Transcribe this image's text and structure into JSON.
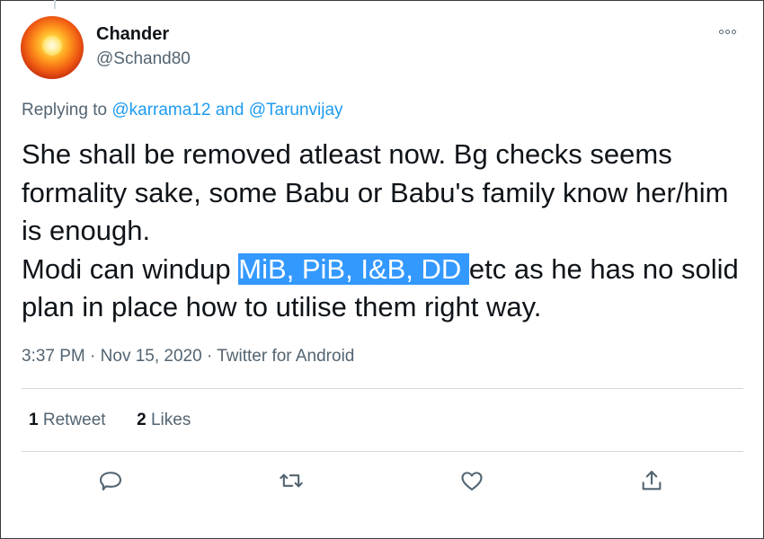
{
  "author": {
    "display_name": "Chander",
    "handle": "@Schand80"
  },
  "reply": {
    "prefix": "Replying to",
    "mention_1": "@karrama12",
    "conjunction": "and",
    "mention_2": "@Tarunvijay"
  },
  "tweet": {
    "line_1": "She shall be removed atleast now. Bg checks seems formality sake, some Babu or Babu's family know her/him is enough.",
    "line_2_before": "Modi can windup ",
    "line_2_highlight": "MiB, PiB, I&B, DD ",
    "line_2_after": "etc as he has no solid plan in place how to utilise them right way.",
    "highlight_color": "#3399ff"
  },
  "meta": {
    "time": "3:37 PM",
    "separator": "·",
    "date": "Nov 15, 2020",
    "source": "Twitter for Android"
  },
  "stats": {
    "retweets_count": "1",
    "retweets_label": "Retweet",
    "likes_count": "2",
    "likes_label": "Likes"
  },
  "actions": {
    "icons": [
      "reply-icon",
      "retweet-icon",
      "like-icon",
      "share-icon"
    ]
  },
  "colors": {
    "accent": "#1d9bf0",
    "secondary_text": "#536471",
    "primary_text": "#0f1419"
  }
}
